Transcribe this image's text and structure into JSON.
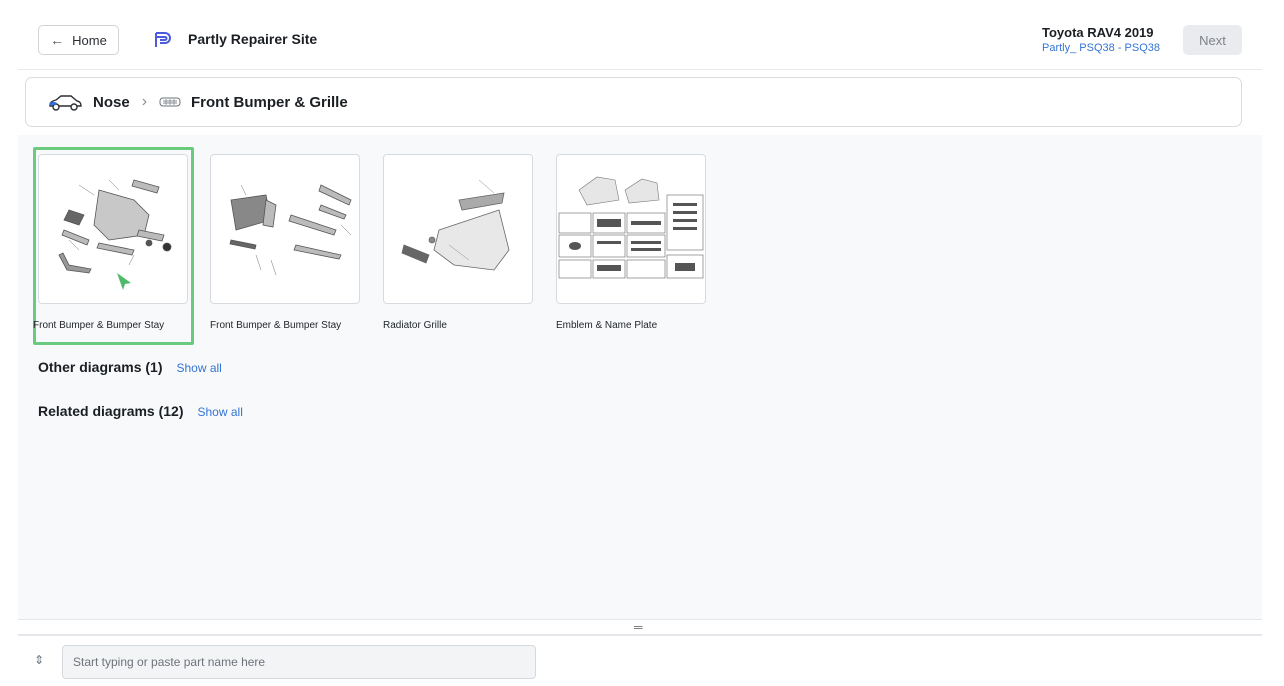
{
  "header": {
    "home_label": "Home",
    "brand_name": "Partly Repairer Site",
    "vehicle_title": "Toyota RAV4 2019",
    "vehicle_sub": "Partly_ PSQ38 - PSQ38",
    "next_label": "Next",
    "brand_color": "#4b5bdc"
  },
  "breadcrumb": {
    "items": [
      {
        "label": "Nose",
        "icon": "car-icon"
      },
      {
        "label": "Front Bumper & Grille",
        "icon": "grille-icon"
      }
    ]
  },
  "diagrams": [
    {
      "label": "Front Bumper & Bumper Stay",
      "selected": true
    },
    {
      "label": "Front Bumper & Bumper Stay",
      "selected": false
    },
    {
      "label": "Radiator Grille",
      "selected": false
    },
    {
      "label": "Emblem & Name Plate",
      "selected": false
    }
  ],
  "other_diagrams": {
    "label": "Other diagrams (1)",
    "show_all": "Show all"
  },
  "related_diagrams": {
    "label": "Related diagrams (12)",
    "show_all": "Show all"
  },
  "search": {
    "placeholder": "Start typing or paste part name here"
  },
  "colors": {
    "selected_outline": "#6acb7e",
    "link": "#3474d4"
  }
}
